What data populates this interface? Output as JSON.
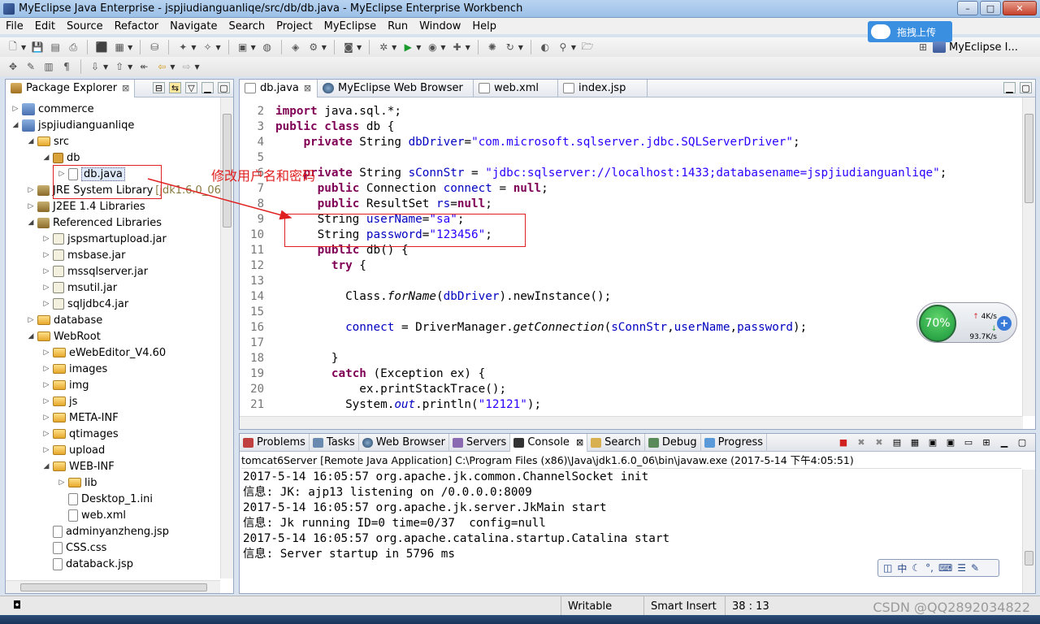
{
  "window": {
    "title": "MyEclipse Java Enterprise - jspjiudianguanliqe/src/db/db.java - MyEclipse Enterprise Workbench",
    "min_label": "–",
    "max_label": "□",
    "close_label": "✕"
  },
  "menu": [
    "File",
    "Edit",
    "Source",
    "Refactor",
    "Navigate",
    "Search",
    "Project",
    "MyEclipse",
    "Run",
    "Window",
    "Help"
  ],
  "upload_widget": {
    "label": "拖拽上传"
  },
  "perspective": {
    "label": "MyEclipse I..."
  },
  "package_explorer": {
    "tab_label": "Package Explorer",
    "tree": [
      {
        "label": "commerce",
        "depth": 0,
        "expanded": false,
        "icon": "project"
      },
      {
        "label": "jspjiudianguanliqe",
        "depth": 0,
        "expanded": true,
        "icon": "project"
      },
      {
        "label": "src",
        "depth": 1,
        "expanded": true,
        "icon": "source-folder"
      },
      {
        "label": "db",
        "depth": 2,
        "expanded": true,
        "icon": "package"
      },
      {
        "label": "db.java",
        "depth": 3,
        "expanded": false,
        "icon": "java-file",
        "selected": true
      },
      {
        "label": "JRE System Library",
        "version": "[jdk1.6.0_06]",
        "depth": 1,
        "expanded": false,
        "icon": "library"
      },
      {
        "label": "J2EE 1.4 Libraries",
        "depth": 1,
        "expanded": false,
        "icon": "library"
      },
      {
        "label": "Referenced Libraries",
        "depth": 1,
        "expanded": true,
        "icon": "library"
      },
      {
        "label": "jspsmartupload.jar",
        "depth": 2,
        "expanded": false,
        "icon": "jar"
      },
      {
        "label": "msbase.jar",
        "depth": 2,
        "expanded": false,
        "icon": "jar"
      },
      {
        "label": "mssqlserver.jar",
        "depth": 2,
        "expanded": false,
        "icon": "jar"
      },
      {
        "label": "msutil.jar",
        "depth": 2,
        "expanded": false,
        "icon": "jar"
      },
      {
        "label": "sqljdbc4.jar",
        "depth": 2,
        "expanded": false,
        "icon": "jar"
      },
      {
        "label": "database",
        "depth": 1,
        "expanded": false,
        "icon": "folder"
      },
      {
        "label": "WebRoot",
        "depth": 1,
        "expanded": true,
        "icon": "folder"
      },
      {
        "label": "eWebEditor_V4.60",
        "depth": 2,
        "expanded": false,
        "icon": "folder"
      },
      {
        "label": "images",
        "depth": 2,
        "expanded": false,
        "icon": "folder"
      },
      {
        "label": "img",
        "depth": 2,
        "expanded": false,
        "icon": "folder"
      },
      {
        "label": "js",
        "depth": 2,
        "expanded": false,
        "icon": "folder"
      },
      {
        "label": "META-INF",
        "depth": 2,
        "expanded": false,
        "icon": "folder"
      },
      {
        "label": "qtimages",
        "depth": 2,
        "expanded": false,
        "icon": "folder"
      },
      {
        "label": "upload",
        "depth": 2,
        "expanded": false,
        "icon": "folder"
      },
      {
        "label": "WEB-INF",
        "depth": 2,
        "expanded": true,
        "icon": "folder"
      },
      {
        "label": "lib",
        "depth": 3,
        "expanded": false,
        "icon": "folder"
      },
      {
        "label": "Desktop_1.ini",
        "depth": 3,
        "expanded": false,
        "icon": "file",
        "leaf": true
      },
      {
        "label": "web.xml",
        "depth": 3,
        "expanded": false,
        "icon": "xml-file",
        "leaf": true
      },
      {
        "label": "adminyanzheng.jsp",
        "depth": 2,
        "expanded": false,
        "icon": "jsp-file",
        "leaf": true
      },
      {
        "label": "CSS.css",
        "depth": 2,
        "expanded": false,
        "icon": "css-file",
        "leaf": true
      },
      {
        "label": "databack.jsp",
        "depth": 2,
        "expanded": false,
        "icon": "jsp-file",
        "leaf": true
      }
    ]
  },
  "editor": {
    "tabs": [
      {
        "label": "db.java",
        "active": true
      },
      {
        "label": "MyEclipse Web Browser",
        "active": false
      },
      {
        "label": "web.xml",
        "active": false
      },
      {
        "label": "index.jsp",
        "active": false
      }
    ],
    "lines": [
      {
        "n": "2",
        "text": "import java.sql.*;"
      },
      {
        "n": "3",
        "text": "public class db {"
      },
      {
        "n": "4",
        "text": "    private String dbDriver=\"com.microsoft.sqlserver.jdbc.SQLServerDriver\";"
      },
      {
        "n": "5",
        "text": ""
      },
      {
        "n": "6",
        "text": "    private String sConnStr = \"jdbc:sqlserver://localhost:1433;databasename=jspjiudianguanliqe\";"
      },
      {
        "n": "7",
        "text": "      public Connection connect = null;"
      },
      {
        "n": "8",
        "text": "      public ResultSet rs=null;"
      },
      {
        "n": "9",
        "text": "      String userName=\"sa\";"
      },
      {
        "n": "10",
        "text": "      String password=\"123456\";"
      },
      {
        "n": "11",
        "text": "      public db() {"
      },
      {
        "n": "12",
        "text": "        try {"
      },
      {
        "n": "13",
        "text": ""
      },
      {
        "n": "14",
        "text": "          Class.forName(dbDriver).newInstance();"
      },
      {
        "n": "15",
        "text": ""
      },
      {
        "n": "16",
        "text": "          connect = DriverManager.getConnection(sConnStr,userName,password);"
      },
      {
        "n": "17",
        "text": ""
      },
      {
        "n": "18",
        "text": "        }"
      },
      {
        "n": "19",
        "text": "        catch (Exception ex) {"
      },
      {
        "n": "20",
        "text": "            ex.printStackTrace();"
      },
      {
        "n": "21",
        "text": "          System.out.println(\"12121\");"
      }
    ]
  },
  "annotation": {
    "text": "修改用户名和密码"
  },
  "console": {
    "tabs": [
      "Problems",
      "Tasks",
      "Web Browser",
      "Servers",
      "Console",
      "Search",
      "Debug",
      "Progress"
    ],
    "active_tab": "Console",
    "description": "tomcat6Server [Remote Java Application] C:\\Program Files (x86)\\Java\\jdk1.6.0_06\\bin\\javaw.exe (2017-5-14 下午4:05:51)",
    "lines": [
      "2017-5-14 16:05:57 org.apache.jk.common.ChannelSocket init",
      "信息: JK: ajp13 listening on /0.0.0.0:8009",
      "2017-5-14 16:05:57 org.apache.jk.server.JkMain start",
      "信息: Jk running ID=0 time=0/37  config=null",
      "2017-5-14 16:05:57 org.apache.catalina.startup.Catalina start",
      "信息: Server startup in 5796 ms"
    ]
  },
  "net_widget": {
    "percent": "70%",
    "up": "4K/s",
    "down": "93.7K/s"
  },
  "status": {
    "writable": "Writable",
    "insert_mode": "Smart Insert",
    "position": "38 : 13"
  },
  "watermark": "CSDN @QQ2892034822",
  "colors": {
    "keyword": "#7f0055",
    "string": "#2a00ff",
    "field": "#0000c0",
    "annotation": "#e02020"
  }
}
